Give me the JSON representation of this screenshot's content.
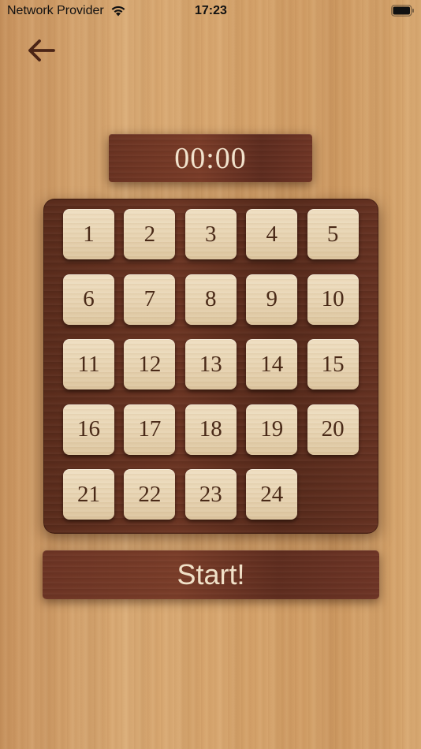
{
  "status": {
    "carrier": "Network Provider",
    "time": "17:23"
  },
  "timer": {
    "value": "00:00"
  },
  "board": {
    "tiles": [
      "1",
      "2",
      "3",
      "4",
      "5",
      "6",
      "7",
      "8",
      "9",
      "10",
      "11",
      "12",
      "13",
      "14",
      "15",
      "16",
      "17",
      "18",
      "19",
      "20",
      "21",
      "22",
      "23",
      "24"
    ]
  },
  "actions": {
    "start_label": "Start!"
  },
  "colors": {
    "wood_light": "#d6a46c",
    "wood_dark": "#6b3523",
    "tile": "#e6d2b0",
    "tile_text": "#4a2a18",
    "panel_text": "#f1e2cc",
    "back_arrow": "#4a2416"
  },
  "icons": {
    "back": "arrow-left-icon",
    "wifi": "wifi-icon",
    "battery": "battery-icon"
  }
}
